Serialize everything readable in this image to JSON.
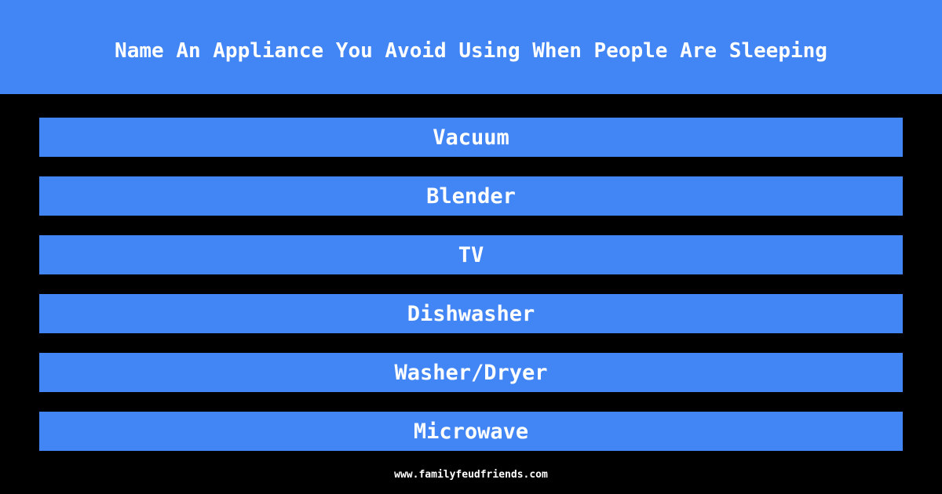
{
  "header": {
    "title": "Name An Appliance You Avoid Using When People Are Sleeping"
  },
  "answers": [
    {
      "label": "Vacuum"
    },
    {
      "label": "Blender"
    },
    {
      "label": "TV"
    },
    {
      "label": "Dishwasher"
    },
    {
      "label": "Washer/Dryer"
    },
    {
      "label": "Microwave"
    }
  ],
  "footer": {
    "site": "www.familyfeudfriends.com"
  },
  "colors": {
    "accent": "#4285f4",
    "background": "#000000",
    "text": "#ffffff"
  }
}
